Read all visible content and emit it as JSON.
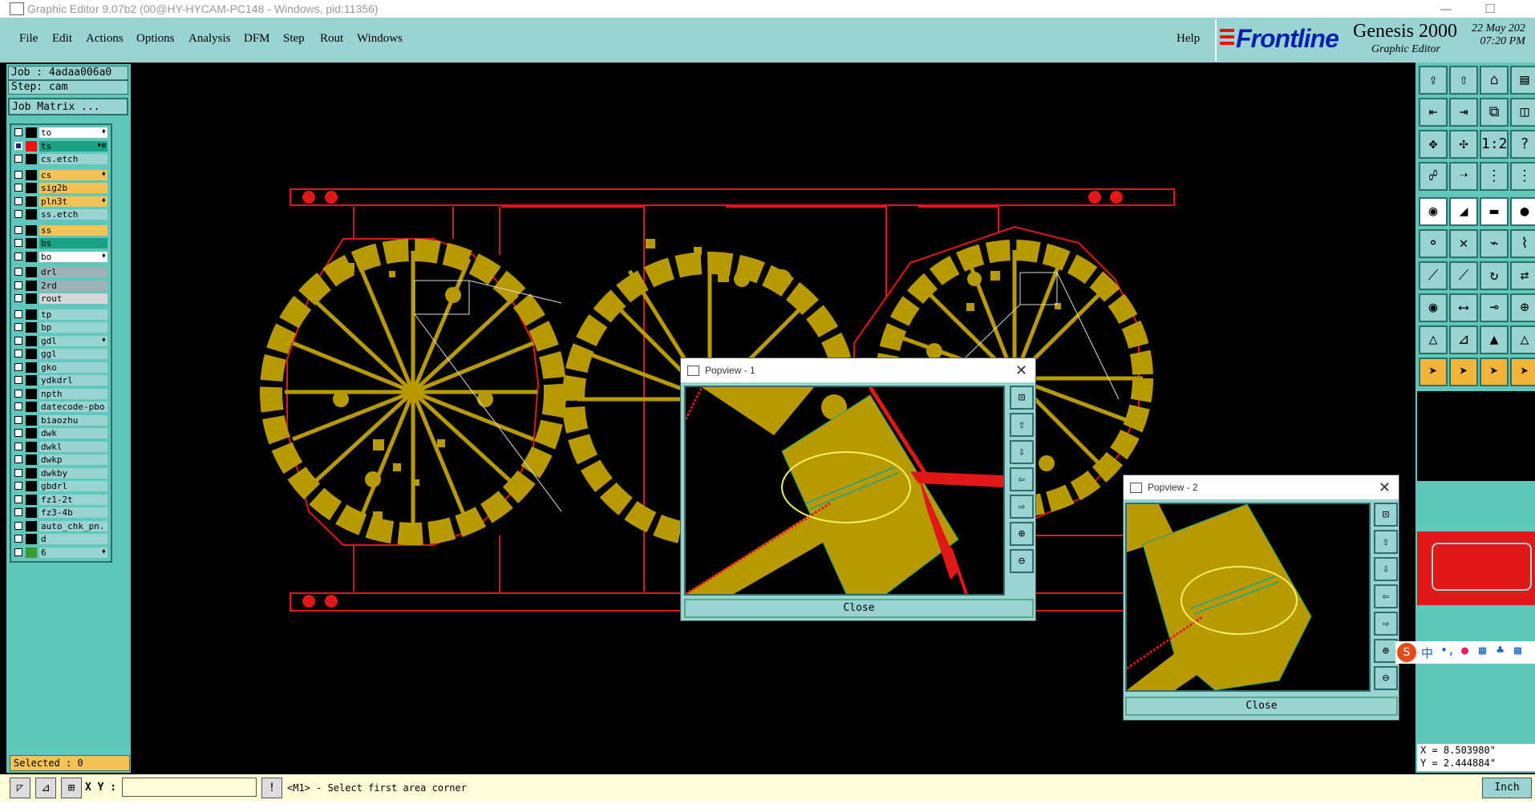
{
  "window": {
    "title": "Graphic Editor 9.07b2 (00@HY-HYCAM-PC148 - Windows, pid:11356)",
    "minimize": "—",
    "maximize": "☐"
  },
  "menu": [
    {
      "id": "file",
      "label": "File"
    },
    {
      "id": "edit",
      "label": "Edit"
    },
    {
      "id": "actions",
      "label": "Actions"
    },
    {
      "id": "options",
      "label": "Options"
    },
    {
      "id": "analysis",
      "label": "Analysis"
    },
    {
      "id": "dfm",
      "label": "DFM"
    },
    {
      "id": "step",
      "label": "Step"
    },
    {
      "id": "rout",
      "label": "Rout"
    },
    {
      "id": "windows",
      "label": "Windows"
    }
  ],
  "help_label": "Help",
  "brand": {
    "company": "Frontline",
    "product": "Genesis 2000",
    "subtitle": "Graphic Editor",
    "date": "22 May 202",
    "time": "07:20 PM",
    "primary_color": "#0a1fb0"
  },
  "job": {
    "job_label": "Job : 4adaa006a0",
    "step_label": "Step: cam",
    "matrix_button": "Job Matrix ..."
  },
  "layers": [
    {
      "name": "to",
      "bg": "#ffffff",
      "swatch": "#000000",
      "flag": "♦",
      "checked": false
    },
    {
      "name": "ts",
      "bg": "#1aa382",
      "swatch": "#e11",
      "flag": "♦⊠",
      "checked": true
    },
    {
      "name": "cs.etch",
      "bg": "#99d4d2",
      "swatch": "#000000",
      "flag": "",
      "checked": false
    },
    {
      "name": "cs",
      "bg": "#f4c255",
      "swatch": "#000000",
      "flag": "♦",
      "checked": false
    },
    {
      "name": "sig2b",
      "bg": "#f4c255",
      "swatch": "#000000",
      "flag": "",
      "checked": false
    },
    {
      "name": "pln3t",
      "bg": "#f4c255",
      "swatch": "#000000",
      "flag": "♦",
      "checked": false
    },
    {
      "name": "ss.etch",
      "bg": "#99d4d2",
      "swatch": "#000000",
      "flag": "",
      "checked": false
    },
    {
      "name": "ss",
      "bg": "#f4c255",
      "swatch": "#000000",
      "flag": "",
      "checked": false
    },
    {
      "name": "bs",
      "bg": "#1aa382",
      "swatch": "#000000",
      "flag": "",
      "checked": false
    },
    {
      "name": "bo",
      "bg": "#ffffff",
      "swatch": "#000000",
      "flag": "♦",
      "checked": false
    },
    {
      "name": "drl",
      "bg": "#9db3b8",
      "swatch": "#000000",
      "flag": "",
      "checked": false
    },
    {
      "name": "2rd",
      "bg": "#9db3b8",
      "swatch": "#000000",
      "flag": "",
      "checked": false
    },
    {
      "name": "rout",
      "bg": "#d8d8d8",
      "swatch": "#000000",
      "flag": "",
      "checked": false
    },
    {
      "name": "tp",
      "bg": "#99d4d2",
      "swatch": "#000000",
      "flag": "",
      "checked": false
    },
    {
      "name": "bp",
      "bg": "#99d4d2",
      "swatch": "#000000",
      "flag": "",
      "checked": false
    },
    {
      "name": "gdl",
      "bg": "#99d4d2",
      "swatch": "#000000",
      "flag": "♦",
      "checked": false
    },
    {
      "name": "ggl",
      "bg": "#99d4d2",
      "swatch": "#000000",
      "flag": "",
      "checked": false
    },
    {
      "name": "gko",
      "bg": "#99d4d2",
      "swatch": "#000000",
      "flag": "",
      "checked": false
    },
    {
      "name": "ydkdrl",
      "bg": "#99d4d2",
      "swatch": "#000000",
      "flag": "",
      "checked": false
    },
    {
      "name": "npth",
      "bg": "#99d4d2",
      "swatch": "#000000",
      "flag": "",
      "checked": false
    },
    {
      "name": "datecode-pbo",
      "bg": "#99d4d2",
      "swatch": "#000000",
      "flag": "",
      "checked": false
    },
    {
      "name": "biaozhu",
      "bg": "#99d4d2",
      "swatch": "#000000",
      "flag": "",
      "checked": false
    },
    {
      "name": "dwk",
      "bg": "#99d4d2",
      "swatch": "#000000",
      "flag": "",
      "checked": false
    },
    {
      "name": "dwkl",
      "bg": "#99d4d2",
      "swatch": "#000000",
      "flag": "",
      "checked": false
    },
    {
      "name": "dwkp",
      "bg": "#99d4d2",
      "swatch": "#000000",
      "flag": "",
      "checked": false
    },
    {
      "name": "dwkby",
      "bg": "#99d4d2",
      "swatch": "#000000",
      "flag": "",
      "checked": false
    },
    {
      "name": "gbdrl",
      "bg": "#99d4d2",
      "swatch": "#000000",
      "flag": "",
      "checked": false
    },
    {
      "name": "fz1-2t",
      "bg": "#99d4d2",
      "swatch": "#000000",
      "flag": "",
      "checked": false
    },
    {
      "name": "fz3-4b",
      "bg": "#99d4d2",
      "swatch": "#000000",
      "flag": "",
      "checked": false
    },
    {
      "name": "auto_chk_pn.",
      "bg": "#99d4d2",
      "swatch": "#000000",
      "flag": "",
      "checked": false
    },
    {
      "name": "d",
      "bg": "#99d4d2",
      "swatch": "#000000",
      "flag": "",
      "checked": false
    },
    {
      "name": "6",
      "bg": "#99d4d2",
      "swatch": "#3a9a2a",
      "flag": "♦",
      "checked": false
    }
  ],
  "selected_label": "Selected : 0",
  "popview1": {
    "title": "Popview - 1",
    "close": "Close"
  },
  "popview2": {
    "title": "Popview - 2",
    "close": "Close"
  },
  "coords": {
    "x": "X = 8.503980\"",
    "y": "Y = 2.444884\""
  },
  "status": {
    "xy_label": "X Y :",
    "xy_value": "",
    "message": "<M1> - Select first area corner",
    "units": "Inch",
    "bottom_text": "..."
  },
  "ime": {
    "label": "中"
  },
  "colors": {
    "panel": "#5fc7bb",
    "button": "#99d4d2",
    "copper": "#b89a00",
    "outline": "#e11818"
  }
}
